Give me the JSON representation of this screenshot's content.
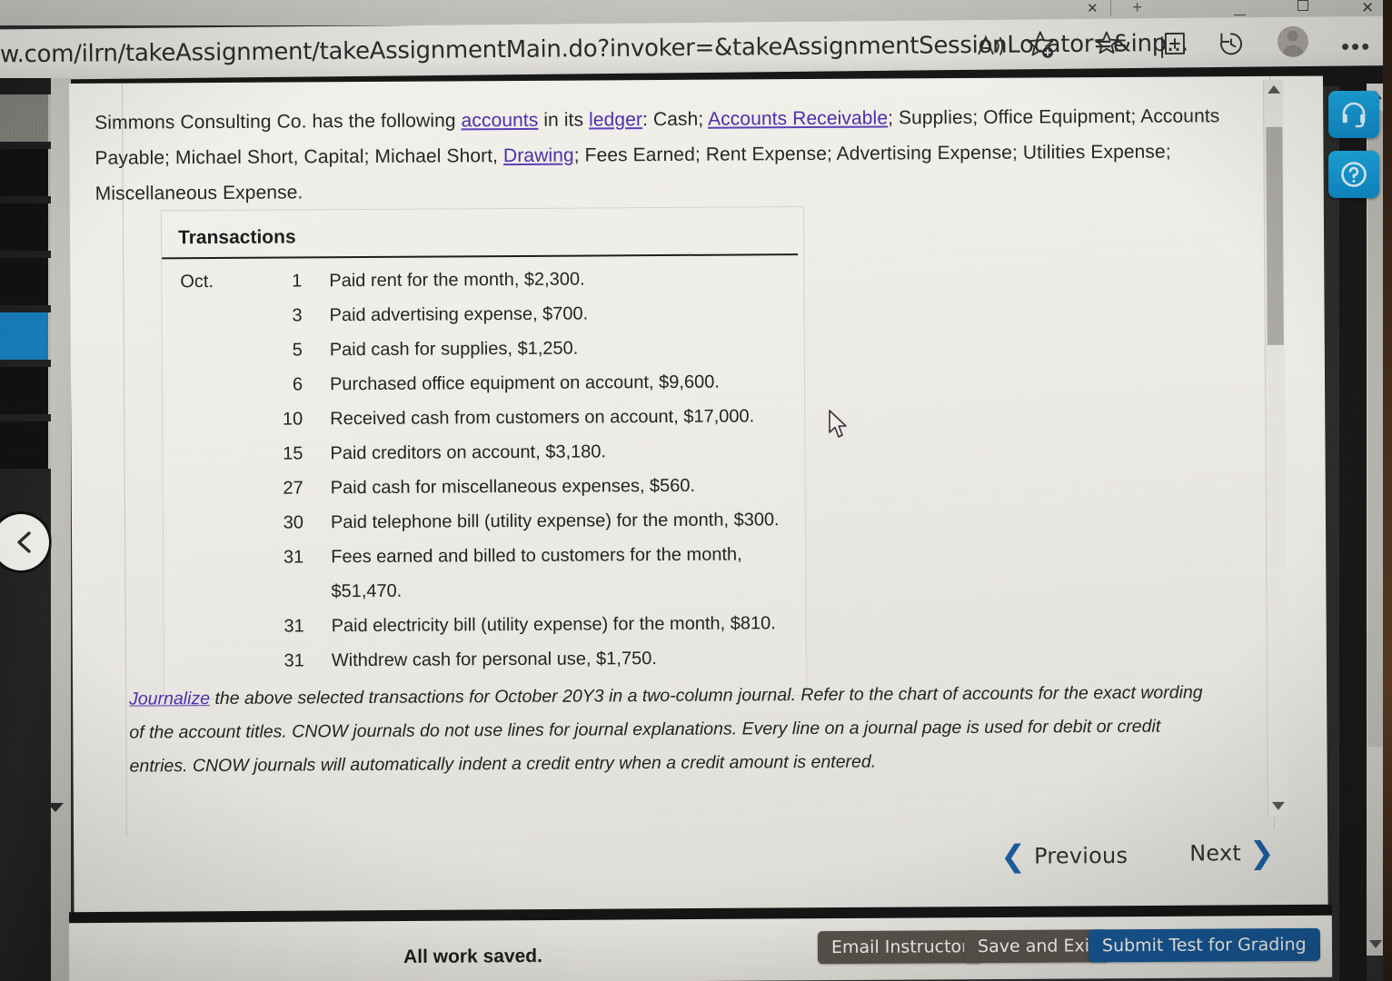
{
  "browser": {
    "url": "w.com/ilrn/takeAssignment/takeAssignmentMain.do?invoker=&takeAssignmentSessionLocator=&inp...",
    "toolbar": {
      "read_aloud": "read-aloud",
      "add_favorite": "add-to-favorites",
      "favorites": "favorites",
      "collections": "collections",
      "history": "history",
      "profile": "profile",
      "more": "•••"
    },
    "window": {
      "tab_close": "✕",
      "new_tab": "+",
      "minimize": "—",
      "maximize": "□",
      "close": "✕"
    }
  },
  "content": {
    "intro": {
      "p1_before_accounts": "Simmons Consulting Co. has the following ",
      "link_accounts": "accounts",
      "p1_mid": " in its ",
      "link_ledger": "ledger",
      "p1_after_ledger": ": Cash; ",
      "link_accounts_receivable": "Accounts Receivable",
      "p1_tail": "; Supplies; Office Equipment; Accounts Payable; Michael Short, Capital; Michael Short, ",
      "link_drawing": "Drawing",
      "p1_end": "; Fees Earned; Rent Expense; Advertising Expense; Utilities Expense; Miscellaneous Expense."
    },
    "transactions": {
      "title": "Transactions",
      "month": "Oct.",
      "rows": [
        {
          "day": "1",
          "desc": "Paid rent for the month, $2,300."
        },
        {
          "day": "3",
          "desc": "Paid advertising expense, $700."
        },
        {
          "day": "5",
          "desc": "Paid cash for supplies, $1,250."
        },
        {
          "day": "6",
          "desc": "Purchased office equipment on account, $9,600."
        },
        {
          "day": "10",
          "desc": "Received cash from customers on account, $17,000."
        },
        {
          "day": "15",
          "desc": "Paid creditors on account, $3,180."
        },
        {
          "day": "27",
          "desc": "Paid cash for miscellaneous expenses, $560."
        },
        {
          "day": "30",
          "desc": "Paid telephone bill (utility expense) for the month, $300."
        },
        {
          "day": "31",
          "desc": "Fees earned and billed to customers for the month, $51,470."
        },
        {
          "day": "31",
          "desc": "Paid electricity bill (utility expense) for the month, $810."
        },
        {
          "day": "31",
          "desc": "Withdrew cash for personal use, $1,750."
        }
      ]
    },
    "instructions": {
      "link_journalize": "Journalize",
      "body": " the above selected transactions for October 20Y3 in a two-column journal. Refer to the chart of accounts for the exact wording of the account titles. CNOW journals do not use lines for journal explanations. Every line on a journal page is used for debit or credit entries. CNOW journals will automatically indent a credit entry when a credit amount is entered."
    }
  },
  "navigation": {
    "previous_label": "Previous",
    "next_label": "Next",
    "previous_chevron": "❮",
    "next_chevron": "❯"
  },
  "footer": {
    "status": "All work saved.",
    "email_instructor": "Email Instructor",
    "save_and_exit": "Save and Exit",
    "submit_test": "Submit Test for Grading"
  },
  "help": {
    "support": "headset-icon",
    "question": "question-mark-icon"
  },
  "colors": {
    "link": "#4b2fa8",
    "accent_blue": "#16548f",
    "chevron_blue": "#1b5c9e",
    "help_button": "#14a0d8",
    "dark_button": "#57514a",
    "rail_accent": "#1679b6"
  }
}
